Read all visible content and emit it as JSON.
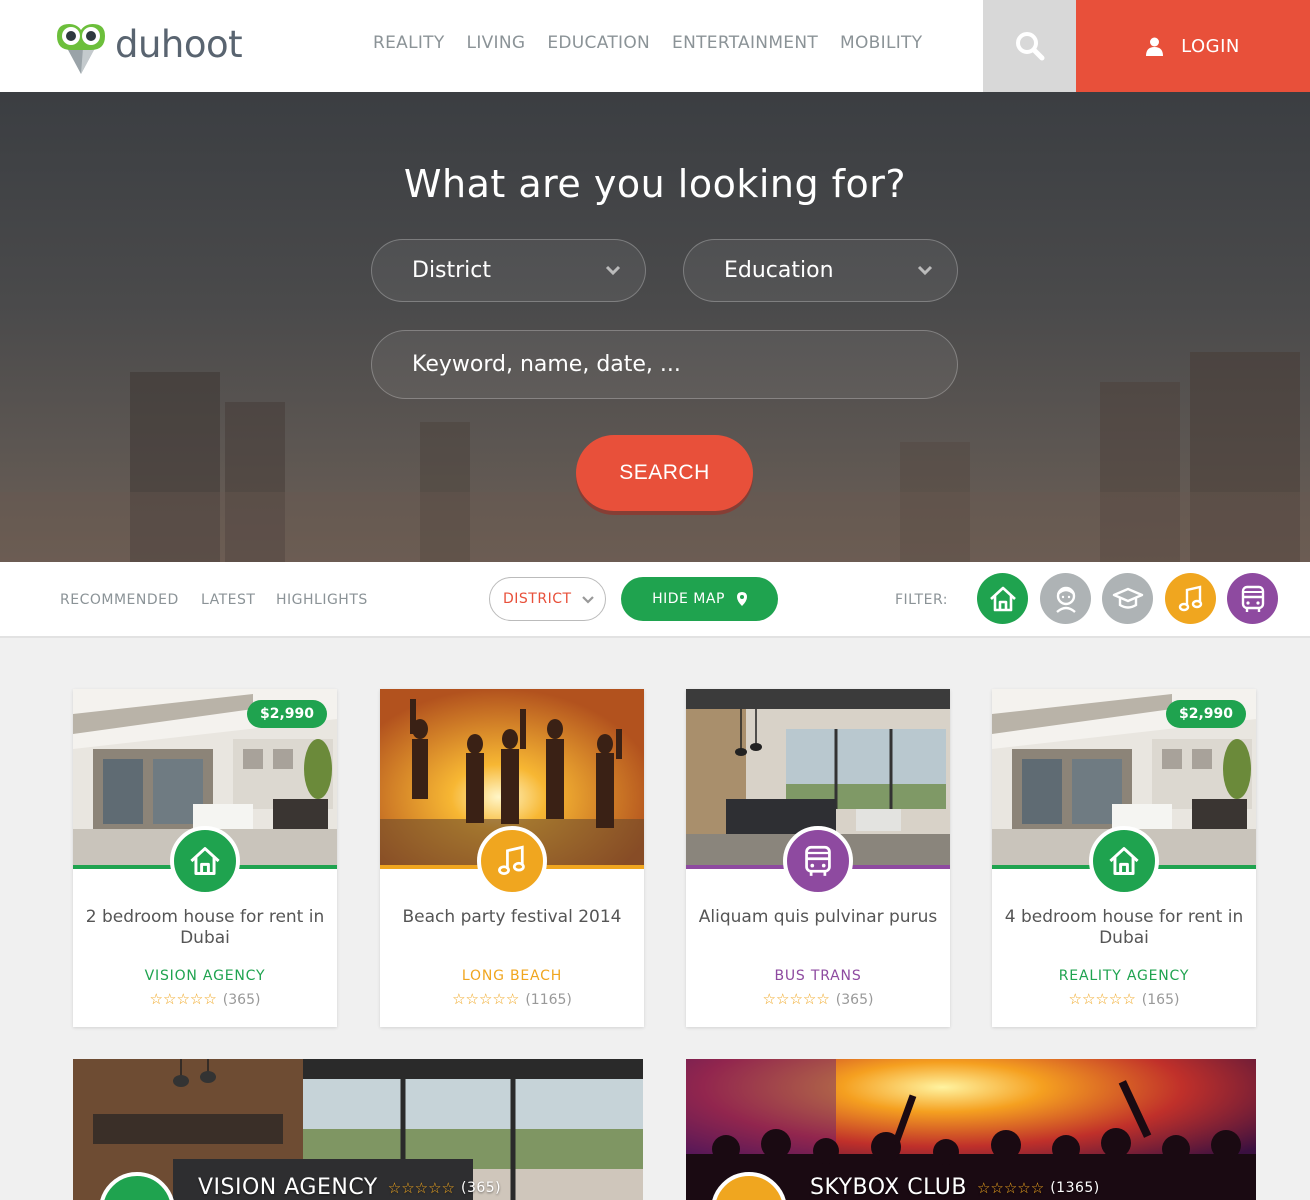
{
  "brand": {
    "name": "duhoot"
  },
  "nav": {
    "items": [
      "REALITY",
      "LIVING",
      "EDUCATION",
      "ENTERTAINMENT",
      "MOBILITY"
    ]
  },
  "header": {
    "login_label": "LOGIN"
  },
  "hero": {
    "title": "What are you looking for?",
    "district_select": "District",
    "category_select": "Education",
    "keyword_placeholder": "Keyword, name, date, ...",
    "search_label": "SEARCH"
  },
  "filterbar": {
    "tabs": [
      "RECOMMENDED",
      "LATEST",
      "HIGHLIGHTS"
    ],
    "district_label": "DISTRICT",
    "hidemap_label": "HIDE MAP",
    "filter_label": "FILTER:",
    "filters": [
      {
        "icon": "house-icon",
        "color": "#1fa34f"
      },
      {
        "icon": "person-icon",
        "color": "#aeb3b5"
      },
      {
        "icon": "graduation-cap-icon",
        "color": "#aeb3b5"
      },
      {
        "icon": "music-note-icon",
        "color": "#f0a61f"
      },
      {
        "icon": "bus-icon",
        "color": "#8e4aa0"
      }
    ]
  },
  "colors": {
    "accent": "#e8503a",
    "green": "#1fa34f",
    "orange": "#f0a61f",
    "purple": "#8e4aa0",
    "grey": "#aeb3b5"
  },
  "cards": [
    {
      "title": "2 bedroom house for rent in Dubai",
      "agency": "VISION AGENCY",
      "stars": "☆☆☆☆☆",
      "count": "(365)",
      "price": "$2,990",
      "icon": "house-icon",
      "color": "#1fa34f"
    },
    {
      "title": "Beach party festival 2014",
      "agency": "LONG BEACH",
      "stars": "☆☆☆☆☆",
      "count": "(1165)",
      "price": "",
      "icon": "music-note-icon",
      "color": "#f0a61f"
    },
    {
      "title": "Aliquam quis pulvinar purus",
      "agency": "BUS TRANS",
      "stars": "☆☆☆☆☆",
      "count": "(365)",
      "price": "",
      "icon": "bus-icon",
      "color": "#8e4aa0"
    },
    {
      "title": "4 bedroom house for rent in Dubai",
      "agency": "REALITY AGENCY",
      "stars": "☆☆☆☆☆",
      "count": "(165)",
      "price": "$2,990",
      "icon": "house-icon",
      "color": "#1fa34f"
    }
  ],
  "featured": [
    {
      "title": "VISION AGENCY",
      "stars": "☆☆☆☆☆",
      "count": "(365)",
      "color": "#1fa34f"
    },
    {
      "title": "SKYBOX CLUB",
      "stars": "☆☆☆☆☆",
      "count": "(1365)",
      "color": "#f0a61f"
    }
  ]
}
